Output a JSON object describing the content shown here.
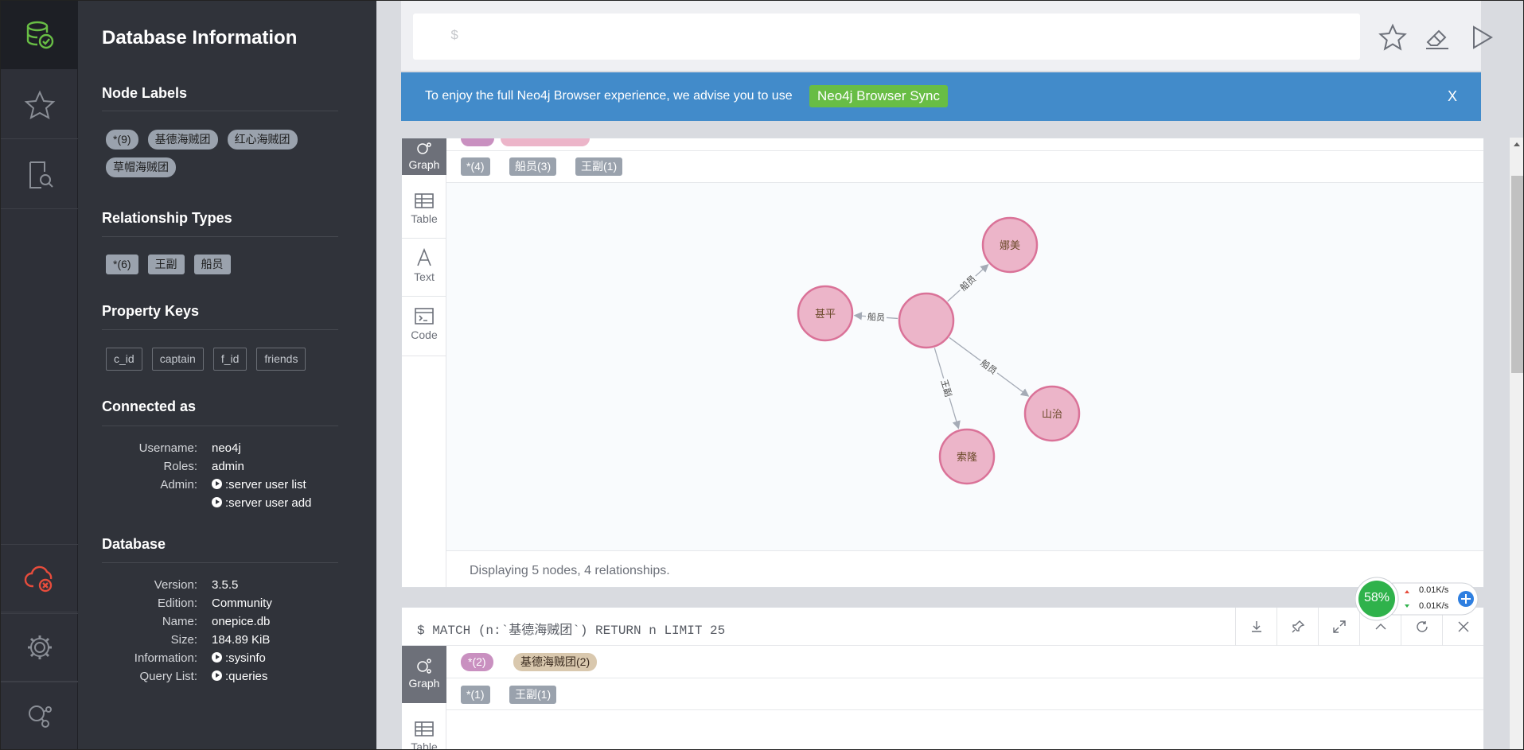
{
  "drawer": {
    "title": "Database Information",
    "node_labels": {
      "title": "Node Labels",
      "items": [
        "*(9)",
        "基德海贼团",
        "红心海贼团",
        "草帽海贼团"
      ]
    },
    "relationship_types": {
      "title": "Relationship Types",
      "items": [
        "*(6)",
        "王副",
        "船员"
      ]
    },
    "property_keys": {
      "title": "Property Keys",
      "items": [
        "c_id",
        "captain",
        "f_id",
        "friends"
      ]
    },
    "connected": {
      "title": "Connected as",
      "username_k": "Username:",
      "username_v": "neo4j",
      "roles_k": "Roles:",
      "roles_v": "admin",
      "admin_k": "Admin:",
      "admin_v1": ":server user list",
      "admin_v2": ":server user add"
    },
    "database": {
      "title": "Database",
      "version_k": "Version:",
      "version_v": "3.5.5",
      "edition_k": "Edition:",
      "edition_v": "Community",
      "name_k": "Name:",
      "name_v": "onepice.db",
      "size_k": "Size:",
      "size_v": "184.89 KiB",
      "info_k": "Information:",
      "info_v": ":sysinfo",
      "ql_k": "Query List:",
      "ql_v": ":queries"
    }
  },
  "editor": {
    "prompt": "$"
  },
  "banner": {
    "message": "To enjoy the full Neo4j Browser experience, we advise you to use",
    "sync": "Neo4j Browser Sync",
    "close": "X"
  },
  "frame1": {
    "tabs": [
      "Graph",
      "Table",
      "Text",
      "Code"
    ],
    "rel_tags": [
      "*(4)",
      "船员(3)",
      "王副(1)"
    ],
    "nodes": [
      "娜美",
      "甚平",
      "山治",
      "索隆",
      ""
    ],
    "edges": [
      "船员",
      "船员",
      "船员",
      "王副"
    ],
    "status": "Displaying 5 nodes, 4 relationships."
  },
  "frame2": {
    "query": "$ MATCH (n:`基德海贼团`) RETURN n LIMIT 25",
    "tabs": [
      "Graph",
      "Table"
    ],
    "labels": [
      "*(2)",
      "基德海贼团(2)"
    ],
    "rel_tags": [
      "*(1)",
      "王副(1)"
    ]
  },
  "monitor": {
    "percent": "58%",
    "up": "0.01K/s",
    "down": "0.01K/s"
  },
  "colors": {
    "node_fill": "#ecb5c9",
    "node_stroke": "#da7298",
    "banner": "#428bca",
    "sync": "#68bd45"
  }
}
